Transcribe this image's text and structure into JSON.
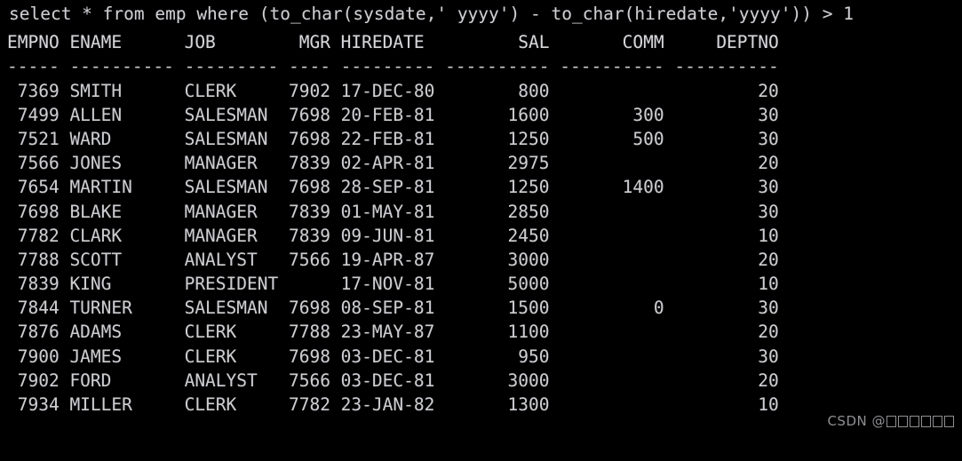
{
  "terminal": {
    "background_color": "#000000",
    "text_color": "#cfcfd2",
    "query": "select * from emp where (to_char(sysdate,' yyyy') - to_char(hiredate,'yyyy')) > 1",
    "blank_line": "",
    "columns": [
      {
        "name": "EMPNO",
        "width": 5,
        "align": "right",
        "dashes": "-----"
      },
      {
        "name": "ENAME",
        "width": 10,
        "align": "left",
        "dashes": "----------"
      },
      {
        "name": "JOB",
        "width": 9,
        "align": "left",
        "dashes": "---------"
      },
      {
        "name": "MGR",
        "width": 4,
        "align": "right",
        "dashes": "----"
      },
      {
        "name": "HIREDATE",
        "width": 9,
        "align": "left",
        "dashes": "---------"
      },
      {
        "name": "SAL",
        "width": 10,
        "align": "right",
        "dashes": "----------"
      },
      {
        "name": "COMM",
        "width": 10,
        "align": "right",
        "dashes": "----------"
      },
      {
        "name": "DEPTNO",
        "width": 10,
        "align": "right",
        "dashes": "----------"
      }
    ],
    "header_row": "EMPNO ENAME      JOB             MGR HIREDATE         SAL       COMM     DEPTNO",
    "separator_row": "----- ---------- --------- ---------- --------- ---------- ---------- ----------",
    "rows": [
      {
        "EMPNO": "7369",
        "ENAME": "SMITH",
        "JOB": "CLERK",
        "MGR": "7902",
        "HIREDATE": "17-DEC-80",
        "SAL": "800",
        "COMM": "",
        "DEPTNO": "20"
      },
      {
        "EMPNO": "7499",
        "ENAME": "ALLEN",
        "JOB": "SALESMAN",
        "MGR": "7698",
        "HIREDATE": "20-FEB-81",
        "SAL": "1600",
        "COMM": "300",
        "DEPTNO": "30"
      },
      {
        "EMPNO": "7521",
        "ENAME": "WARD",
        "JOB": "SALESMAN",
        "MGR": "7698",
        "HIREDATE": "22-FEB-81",
        "SAL": "1250",
        "COMM": "500",
        "DEPTNO": "30"
      },
      {
        "EMPNO": "7566",
        "ENAME": "JONES",
        "JOB": "MANAGER",
        "MGR": "7839",
        "HIREDATE": "02-APR-81",
        "SAL": "2975",
        "COMM": "",
        "DEPTNO": "20"
      },
      {
        "EMPNO": "7654",
        "ENAME": "MARTIN",
        "JOB": "SALESMAN",
        "MGR": "7698",
        "HIREDATE": "28-SEP-81",
        "SAL": "1250",
        "COMM": "1400",
        "DEPTNO": "30"
      },
      {
        "EMPNO": "7698",
        "ENAME": "BLAKE",
        "JOB": "MANAGER",
        "MGR": "7839",
        "HIREDATE": "01-MAY-81",
        "SAL": "2850",
        "COMM": "",
        "DEPTNO": "30"
      },
      {
        "EMPNO": "7782",
        "ENAME": "CLARK",
        "JOB": "MANAGER",
        "MGR": "7839",
        "HIREDATE": "09-JUN-81",
        "SAL": "2450",
        "COMM": "",
        "DEPTNO": "10"
      },
      {
        "EMPNO": "7788",
        "ENAME": "SCOTT",
        "JOB": "ANALYST",
        "MGR": "7566",
        "HIREDATE": "19-APR-87",
        "SAL": "3000",
        "COMM": "",
        "DEPTNO": "20"
      },
      {
        "EMPNO": "7839",
        "ENAME": "KING",
        "JOB": "PRESIDENT",
        "MGR": "",
        "HIREDATE": "17-NOV-81",
        "SAL": "5000",
        "COMM": "",
        "DEPTNO": "10"
      },
      {
        "EMPNO": "7844",
        "ENAME": "TURNER",
        "JOB": "SALESMAN",
        "MGR": "7698",
        "HIREDATE": "08-SEP-81",
        "SAL": "1500",
        "COMM": "0",
        "DEPTNO": "30"
      },
      {
        "EMPNO": "7876",
        "ENAME": "ADAMS",
        "JOB": "CLERK",
        "MGR": "7788",
        "HIREDATE": "23-MAY-87",
        "SAL": "1100",
        "COMM": "",
        "DEPTNO": "20"
      },
      {
        "EMPNO": "7900",
        "ENAME": "JAMES",
        "JOB": "CLERK",
        "MGR": "7698",
        "HIREDATE": "03-DEC-81",
        "SAL": "950",
        "COMM": "",
        "DEPTNO": "30"
      },
      {
        "EMPNO": "7902",
        "ENAME": "FORD",
        "JOB": "ANALYST",
        "MGR": "7566",
        "HIREDATE": "03-DEC-81",
        "SAL": "3000",
        "COMM": "",
        "DEPTNO": "20"
      },
      {
        "EMPNO": "7934",
        "ENAME": "MILLER",
        "JOB": "CLERK",
        "MGR": "7782",
        "HIREDATE": "23-JAN-82",
        "SAL": "1300",
        "COMM": "",
        "DEPTNO": "10"
      }
    ]
  },
  "watermark": {
    "prefix": "CSDN @",
    "username_glyph_count": 6,
    "color": "#8f8f93"
  }
}
